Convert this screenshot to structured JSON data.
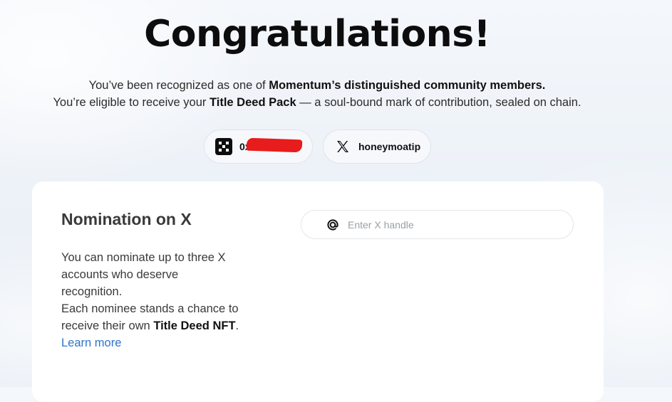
{
  "header": {
    "title": "Congratulations!",
    "line1_prefix": "You’ve been recognized as one of ",
    "line1_bold": "Momentum’s distinguished community members.",
    "line2_prefix": "You’re eligible to receive your ",
    "line2_bold": "Title Deed Pack",
    "line2_suffix": " — a soul-bound mark of contribution, sealed on chain."
  },
  "accounts": {
    "wallet_icon": "okx-wallet-icon",
    "wallet_address": "0x0",
    "x_icon": "x-logo-icon",
    "x_handle": "honeymoatip"
  },
  "nomination": {
    "title": "Nomination on X",
    "body_part1": "You can nominate up to three X accounts who deserve recognition.",
    "body_part2_prefix": "Each nominee stands a chance to receive their own ",
    "body_part2_bold": "Title Deed NFT",
    "body_part2_suffix": ".",
    "learn_more": "Learn more",
    "input_icon": "at-sign-icon",
    "input_placeholder": "Enter X handle",
    "input_value": ""
  },
  "colors": {
    "link": "#2f73c8",
    "redaction": "#e81c1c"
  }
}
